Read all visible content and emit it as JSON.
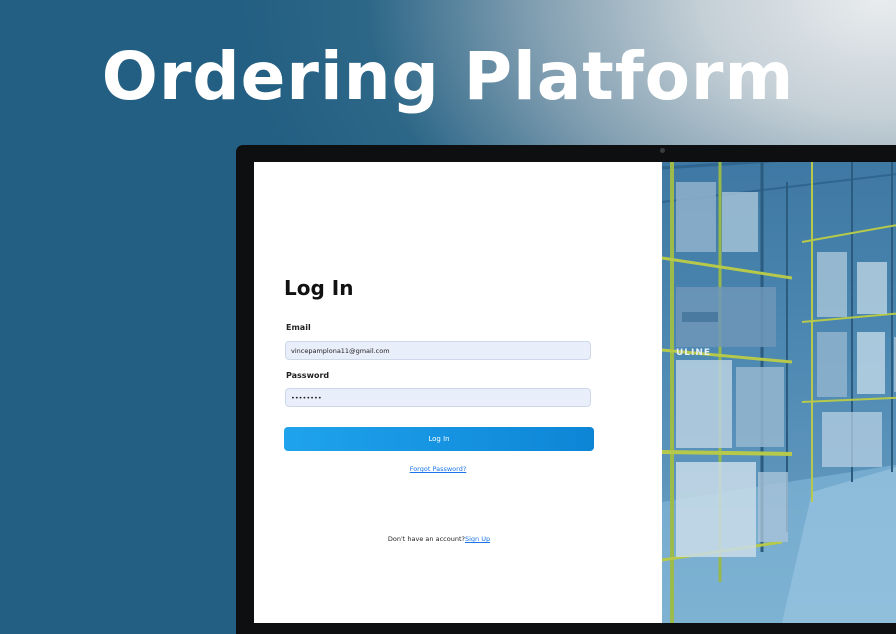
{
  "hero": {
    "title": "Ordering Platform"
  },
  "login": {
    "title": "Log In",
    "email_label": "Email",
    "email_value": "vincepamplona11@gmail.com",
    "password_label": "Password",
    "password_value": "••••••••",
    "login_button": "Log In",
    "forgot_password": "Forgot Password?",
    "signup_prompt": "Don't have an account?",
    "signup_link": "Sign Up"
  },
  "warehouse_image": {
    "sign_text": "ULINE"
  },
  "colors": {
    "background": "#235f82",
    "button_start": "#1fa3ec",
    "button_end": "#0d85d6",
    "input_bg": "#e8eefa",
    "link": "#1a73e8"
  }
}
